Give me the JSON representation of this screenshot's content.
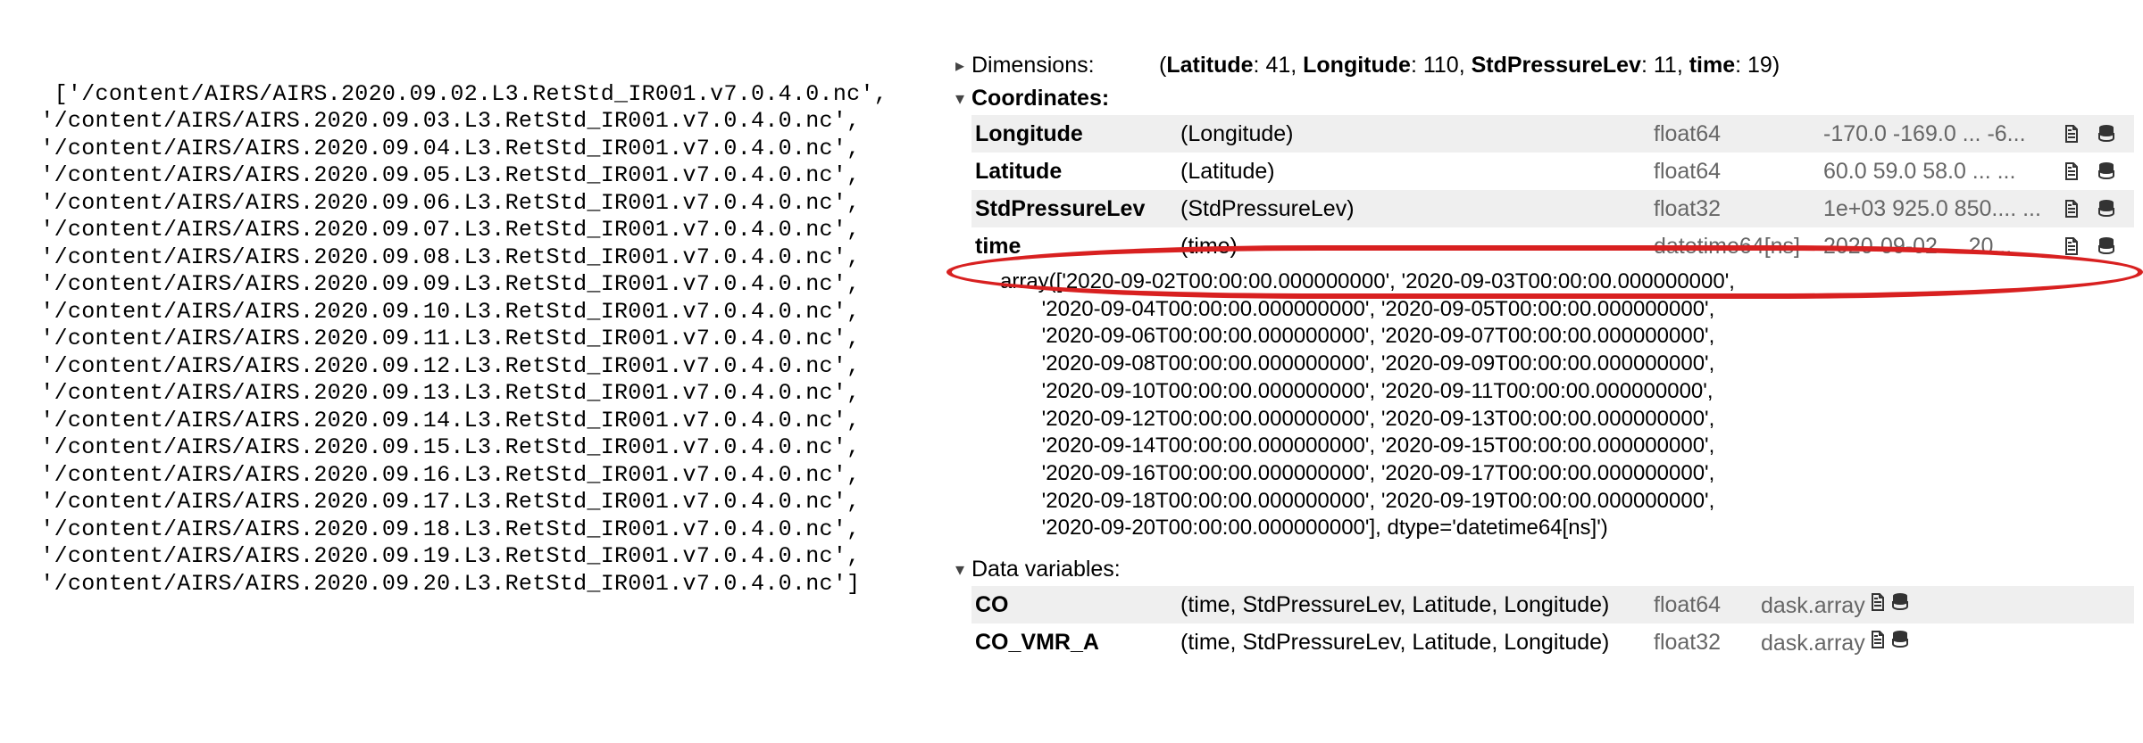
{
  "fileList": [
    "'/content/AIRS/AIRS.2020.09.02.L3.RetStd_IR001.v7.0.4.0.nc',",
    " '/content/AIRS/AIRS.2020.09.03.L3.RetStd_IR001.v7.0.4.0.nc',",
    " '/content/AIRS/AIRS.2020.09.04.L3.RetStd_IR001.v7.0.4.0.nc',",
    " '/content/AIRS/AIRS.2020.09.05.L3.RetStd_IR001.v7.0.4.0.nc',",
    " '/content/AIRS/AIRS.2020.09.06.L3.RetStd_IR001.v7.0.4.0.nc',",
    " '/content/AIRS/AIRS.2020.09.07.L3.RetStd_IR001.v7.0.4.0.nc',",
    " '/content/AIRS/AIRS.2020.09.08.L3.RetStd_IR001.v7.0.4.0.nc',",
    " '/content/AIRS/AIRS.2020.09.09.L3.RetStd_IR001.v7.0.4.0.nc',",
    " '/content/AIRS/AIRS.2020.09.10.L3.RetStd_IR001.v7.0.4.0.nc',",
    " '/content/AIRS/AIRS.2020.09.11.L3.RetStd_IR001.v7.0.4.0.nc',",
    " '/content/AIRS/AIRS.2020.09.12.L3.RetStd_IR001.v7.0.4.0.nc',",
    " '/content/AIRS/AIRS.2020.09.13.L3.RetStd_IR001.v7.0.4.0.nc',",
    " '/content/AIRS/AIRS.2020.09.14.L3.RetStd_IR001.v7.0.4.0.nc',",
    " '/content/AIRS/AIRS.2020.09.15.L3.RetStd_IR001.v7.0.4.0.nc',",
    " '/content/AIRS/AIRS.2020.09.16.L3.RetStd_IR001.v7.0.4.0.nc',",
    " '/content/AIRS/AIRS.2020.09.17.L3.RetStd_IR001.v7.0.4.0.nc',",
    " '/content/AIRS/AIRS.2020.09.18.L3.RetStd_IR001.v7.0.4.0.nc',",
    " '/content/AIRS/AIRS.2020.09.19.L3.RetStd_IR001.v7.0.4.0.nc',",
    " '/content/AIRS/AIRS.2020.09.20.L3.RetStd_IR001.v7.0.4.0.nc']"
  ],
  "dimensions": {
    "label": "Dimensions:",
    "items": [
      {
        "name": "Latitude",
        "size": 41
      },
      {
        "name": "Longitude",
        "size": 110
      },
      {
        "name": "StdPressureLev",
        "size": 11
      },
      {
        "name": "time",
        "size": 19
      }
    ]
  },
  "coordinates": {
    "label": "Coordinates:",
    "rows": [
      {
        "name": "Longitude",
        "dims": "(Longitude)",
        "dtype": "float64",
        "preview": "-170.0 -169.0 ... -6..."
      },
      {
        "name": "Latitude",
        "dims": "(Latitude)",
        "dtype": "float64",
        "preview": "60.0 59.0 58.0 ... ..."
      },
      {
        "name": "StdPressureLev",
        "dims": "(StdPressureLev)",
        "dtype": "float32",
        "preview": "1e+03 925.0 850.... ..."
      },
      {
        "name": "time",
        "dims": "(time)",
        "dtype": "datetime64[ns]",
        "preview": "2020-09-02 ... 20..."
      }
    ]
  },
  "timeArrayLines": [
    "array(['2020-09-02T00:00:00.000000000', '2020-09-03T00:00:00.000000000',",
    "       '2020-09-04T00:00:00.000000000', '2020-09-05T00:00:00.000000000',",
    "       '2020-09-06T00:00:00.000000000', '2020-09-07T00:00:00.000000000',",
    "       '2020-09-08T00:00:00.000000000', '2020-09-09T00:00:00.000000000',",
    "       '2020-09-10T00:00:00.000000000', '2020-09-11T00:00:00.000000000',",
    "       '2020-09-12T00:00:00.000000000', '2020-09-13T00:00:00.000000000',",
    "       '2020-09-14T00:00:00.000000000', '2020-09-15T00:00:00.000000000',",
    "       '2020-09-16T00:00:00.000000000', '2020-09-17T00:00:00.000000000',",
    "       '2020-09-18T00:00:00.000000000', '2020-09-19T00:00:00.000000000',",
    "       '2020-09-20T00:00:00.000000000'], dtype='datetime64[ns]')"
  ],
  "dataVariables": {
    "label": "Data variables:",
    "rows": [
      {
        "name": "CO",
        "dims": "(time, StdPressureLev, Latitude, Longitude)",
        "dtype": "float64",
        "preview": "dask.array<chunk..."
      },
      {
        "name": "CO_VMR_A",
        "dims": "(time, StdPressureLev, Latitude, Longitude)",
        "dtype": "float32",
        "preview": "dask.array<chunk..."
      }
    ]
  },
  "icons": {
    "doc": "📄",
    "db": "🗄"
  }
}
